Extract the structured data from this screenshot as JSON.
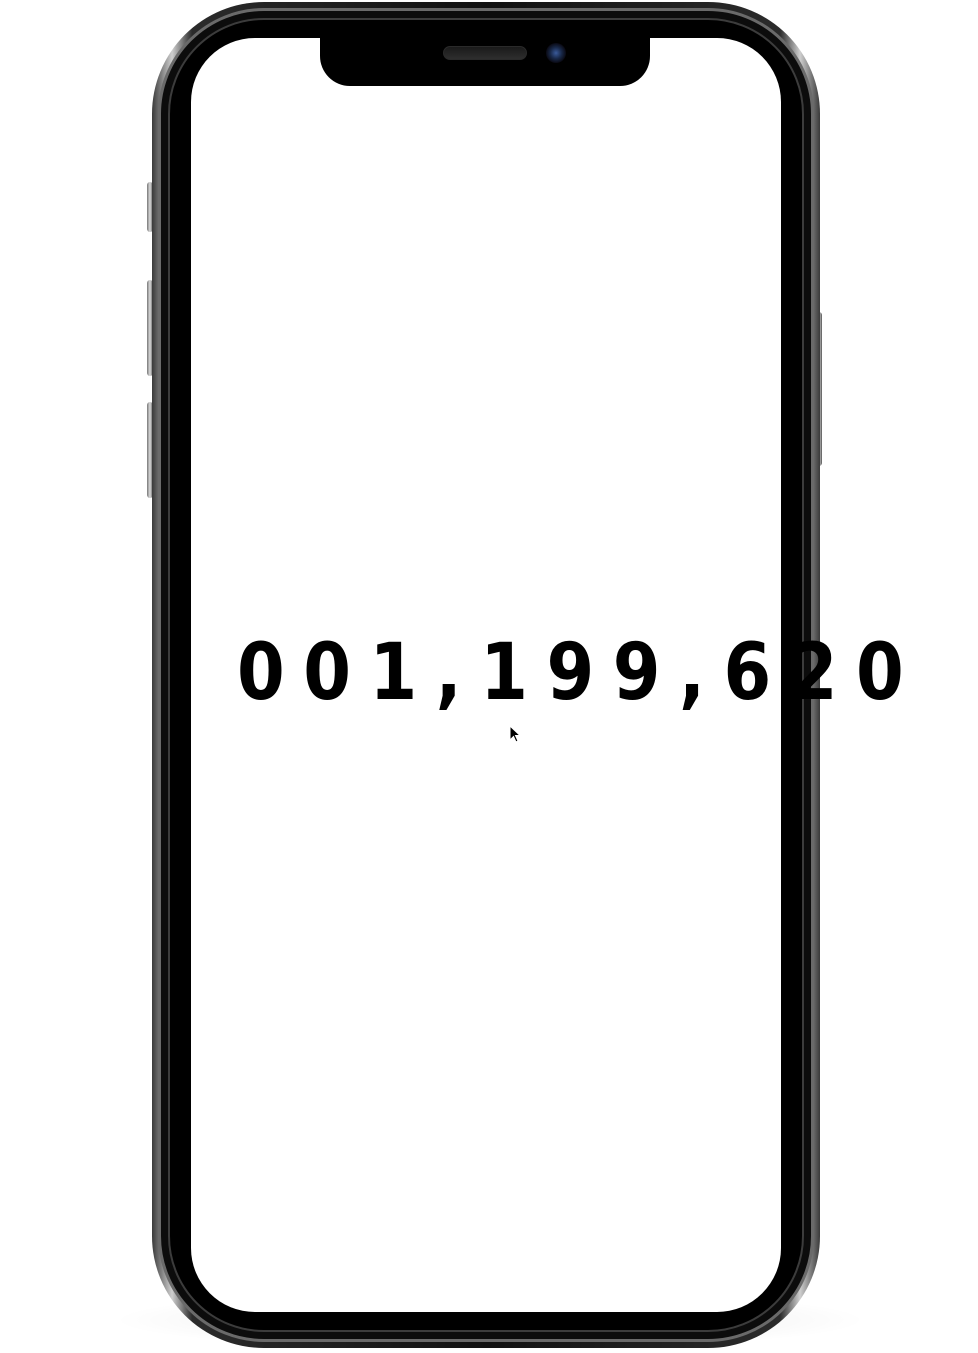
{
  "counter": {
    "value": "001,199,620"
  },
  "icons": {
    "cursor": "mouse-pointer-icon",
    "camera": "front-camera-icon",
    "speaker": "earpiece-speaker-icon"
  },
  "colors": {
    "screen_background": "#ffffff",
    "text": "#000000",
    "frame": "#111111"
  }
}
